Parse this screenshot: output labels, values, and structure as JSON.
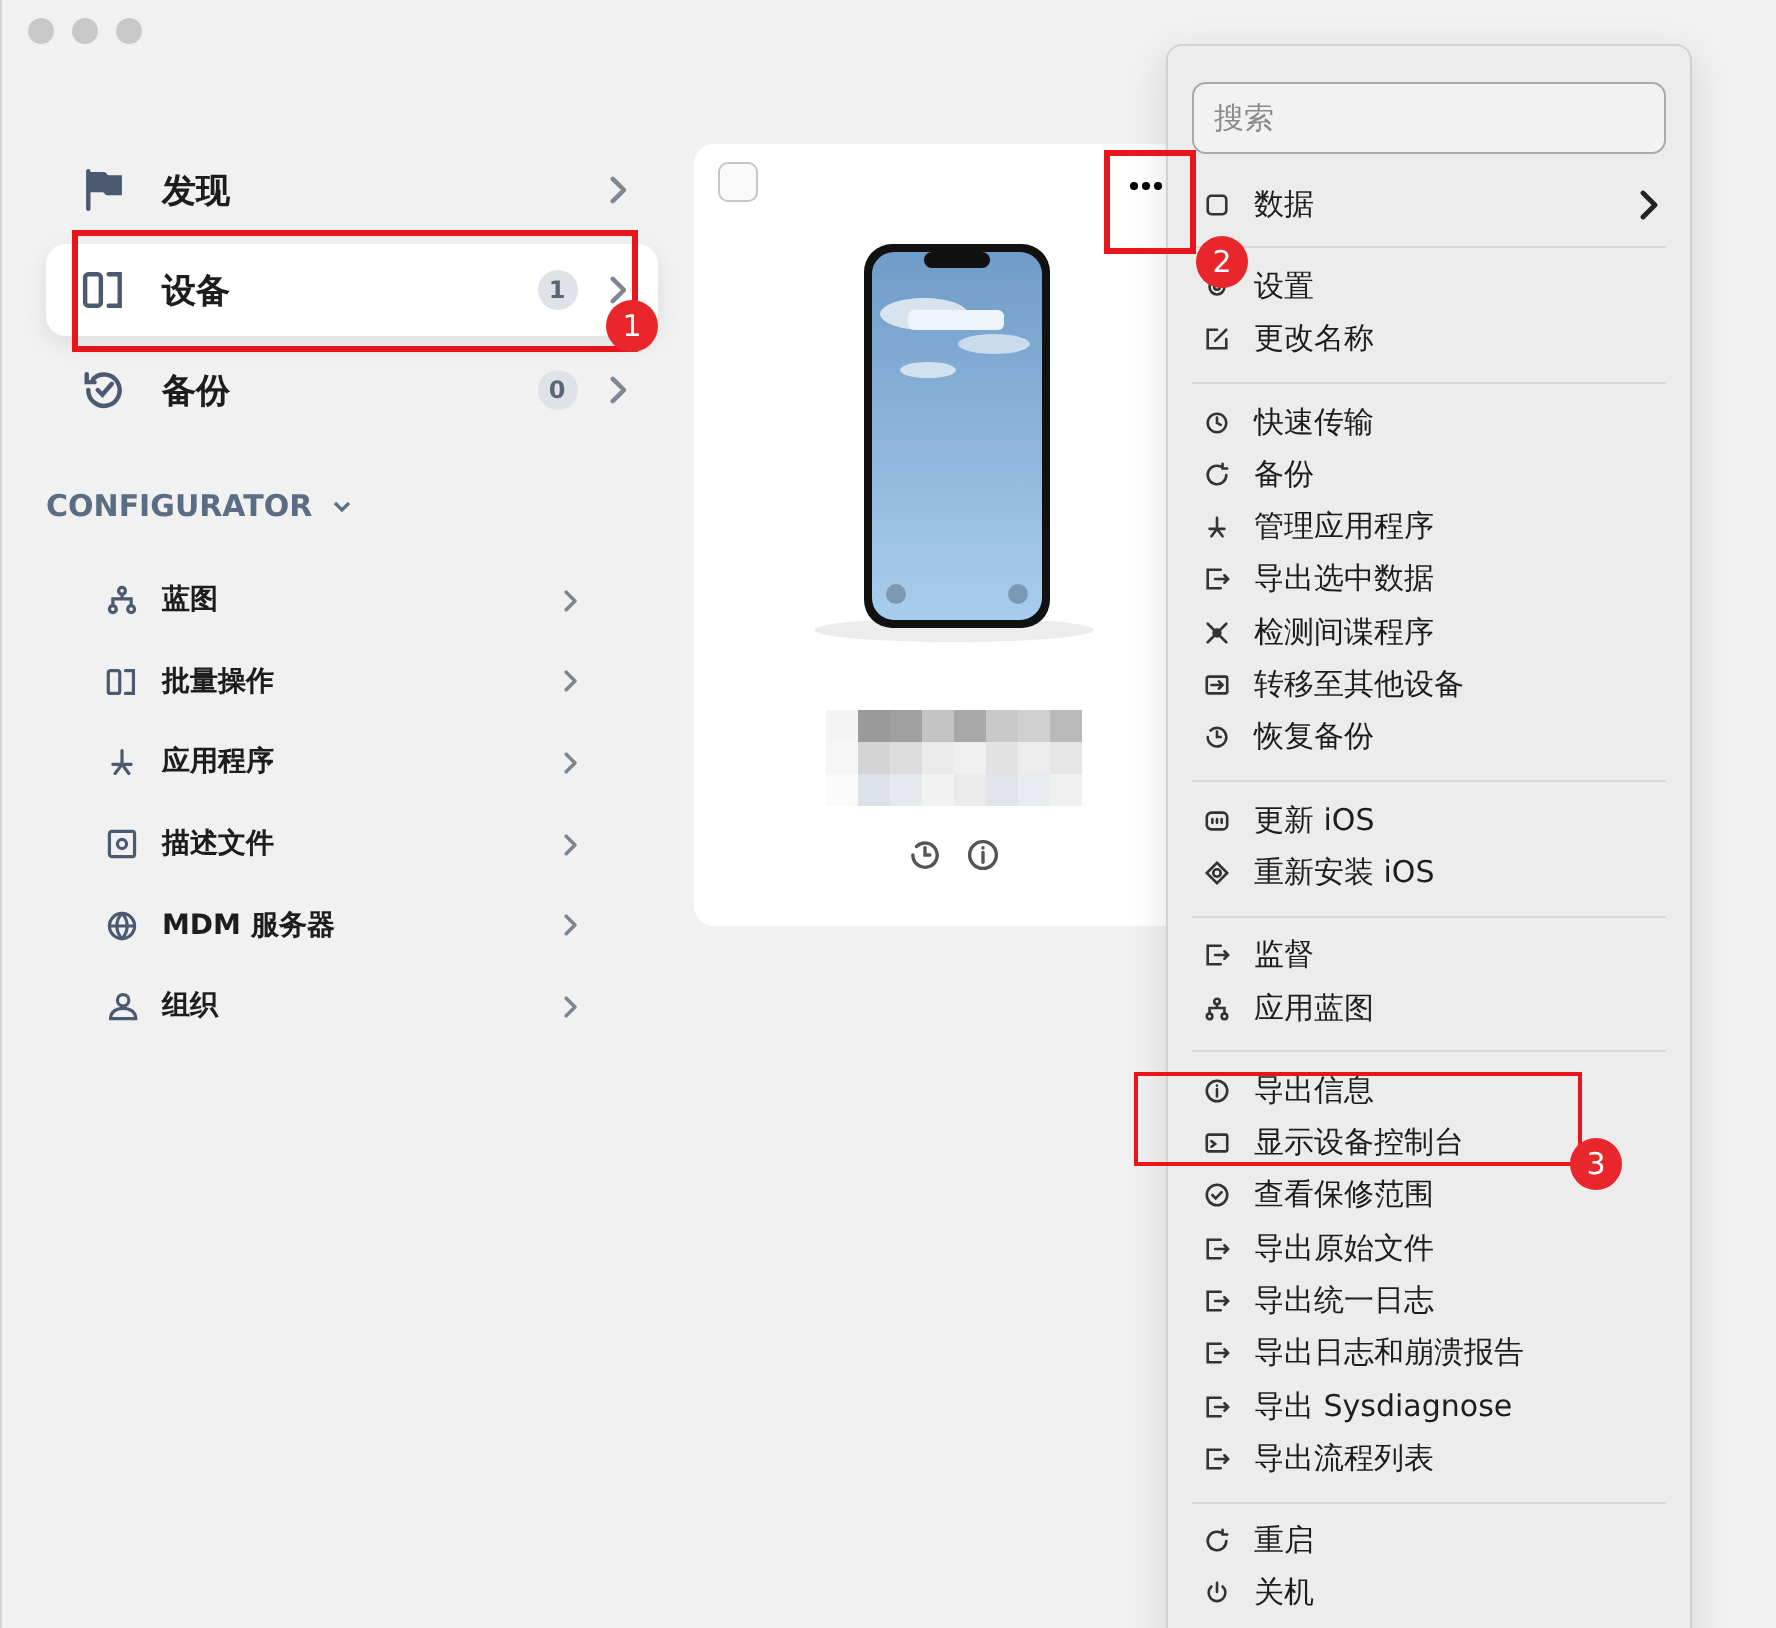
{
  "sidebar": {
    "items": [
      {
        "label": "发现",
        "selected": false
      },
      {
        "label": "设备",
        "selected": true,
        "count": "1"
      },
      {
        "label": "备份",
        "selected": false,
        "count": "0"
      }
    ],
    "section": {
      "title": "CONFIGURATOR",
      "expanded": true,
      "items": [
        {
          "label": "蓝图"
        },
        {
          "label": "批量操作"
        },
        {
          "label": "应用程序"
        },
        {
          "label": "描述文件"
        },
        {
          "label": "MDM 服务器"
        },
        {
          "label": "组织"
        }
      ]
    }
  },
  "device_card": {
    "checked": false
  },
  "menu": {
    "search": {
      "placeholder": "搜索"
    },
    "groups": [
      [
        {
          "label": "数据",
          "kind": "submenu"
        }
      ],
      [
        {
          "label": "设置",
          "kind": "item"
        },
        {
          "label": "更改名称",
          "kind": "item"
        }
      ],
      [
        {
          "label": "快速传输",
          "kind": "item"
        },
        {
          "label": "备份",
          "kind": "item"
        },
        {
          "label": "管理应用程序",
          "kind": "item"
        },
        {
          "label": "导出选中数据",
          "kind": "item"
        },
        {
          "label": "检测间谍程序",
          "kind": "item"
        },
        {
          "label": "转移至其他设备",
          "kind": "item"
        },
        {
          "label": "恢复备份",
          "kind": "item"
        }
      ],
      [
        {
          "label": "更新 iOS",
          "kind": "item"
        },
        {
          "label": "重新安装 iOS",
          "kind": "item"
        }
      ],
      [
        {
          "label": "监督",
          "kind": "item"
        },
        {
          "label": "应用蓝图",
          "kind": "item"
        }
      ],
      [
        {
          "label": "导出信息",
          "kind": "item"
        },
        {
          "label": "显示设备控制台",
          "kind": "item"
        },
        {
          "label": "查看保修范围",
          "kind": "item"
        },
        {
          "label": "导出原始文件",
          "kind": "item"
        },
        {
          "label": "导出统一日志",
          "kind": "item"
        },
        {
          "label": "导出日志和崩溃报告",
          "kind": "item"
        },
        {
          "label": "导出 Sysdiagnose",
          "kind": "item"
        },
        {
          "label": "导出流程列表",
          "kind": "item"
        }
      ],
      [
        {
          "label": "重启",
          "kind": "item"
        },
        {
          "label": "关机",
          "kind": "item"
        }
      ]
    ]
  },
  "annotations": [
    {
      "number": "1"
    },
    {
      "number": "2"
    },
    {
      "number": "3"
    }
  ]
}
